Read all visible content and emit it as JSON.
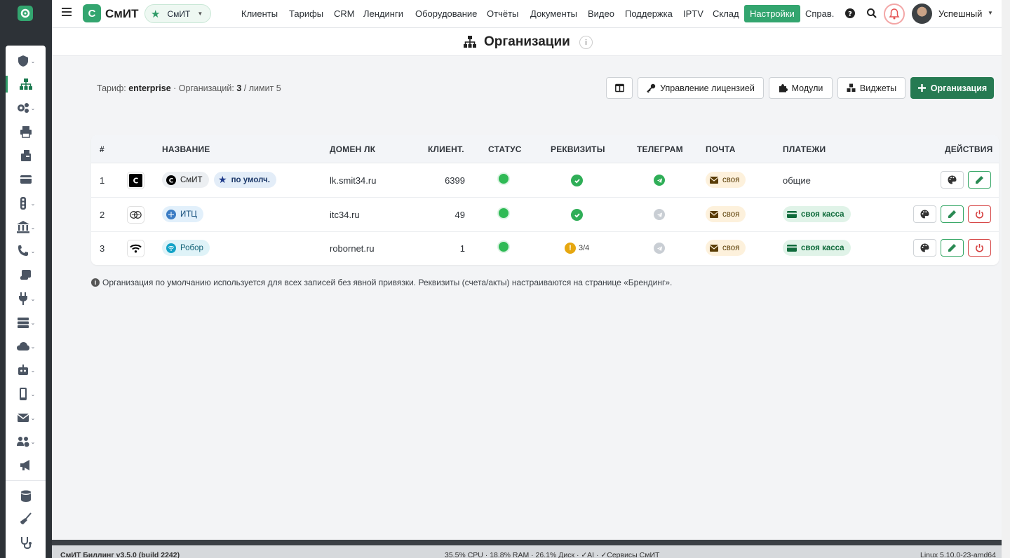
{
  "topbar": {
    "brand_letter": "С",
    "brand_name": "СмИТ",
    "org_selector": "СмИТ",
    "nav": [
      "Клиенты",
      "Тарифы",
      "CRM",
      "Лендинги",
      "Оборудование",
      "Отчёты",
      "Документы",
      "Видео",
      "Поддержка",
      "IPTV",
      "Склад",
      "Настройки",
      "Справ."
    ],
    "active_nav": "Настройки",
    "user_name": "Успешный"
  },
  "page": {
    "title": "Организации",
    "info_icon": "i"
  },
  "summary": {
    "tariff_label": "Тариф:",
    "tariff_value": "enterprise",
    "orgs_label": "· Организаций:",
    "orgs_count": "3",
    "limit_text": "/ лимит 5"
  },
  "toolbar": {
    "license_label": "Управление лицензией",
    "modules_label": "Модули",
    "widgets_label": "Виджеты",
    "add_label": "Организация"
  },
  "table": {
    "headers": [
      "#",
      "НАЗВАНИЕ",
      "ДОМЕН ЛК",
      "КЛИЕНТ.",
      "СТАТУС",
      "РЕКВИЗИТЫ",
      "ТЕЛЕГРАМ",
      "ПОЧТА",
      "ПЛАТЕЖИ",
      "ДЕЙСТВИЯ"
    ],
    "rows": [
      {
        "num": "1",
        "name": "СмИТ",
        "default_badge": "по умолч.",
        "domain": "lk.smit34.ru",
        "clients": "6399",
        "mail": "своя",
        "payments": "общие"
      },
      {
        "num": "2",
        "name": "ИТЦ",
        "domain": "itc34.ru",
        "clients": "49",
        "mail": "своя",
        "payments": "своя касса"
      },
      {
        "num": "3",
        "name": "Робор",
        "domain": "robornet.ru",
        "clients": "1",
        "mail": "своя",
        "payments": "своя касса",
        "requisites": "3/4"
      }
    ]
  },
  "note": "Организация по умолчанию используется для всех записей без явной привязки. Реквизиты (счета/акты) настраиваются на странице «Брендинг».",
  "footer": {
    "left": "СмИТ Биллинг v3.5.0 (build 2242)",
    "center": "35.5% CPU · 18.8% RAM · 26.1% Диск · ✓AI · ✓Сервисы СмИТ",
    "right": "Linux 5.10.0-23-amd64"
  },
  "colors": {
    "accent": "#33a56f",
    "primary_button": "#267a52",
    "danger": "#d43b3b",
    "warning": "#e6a710"
  }
}
